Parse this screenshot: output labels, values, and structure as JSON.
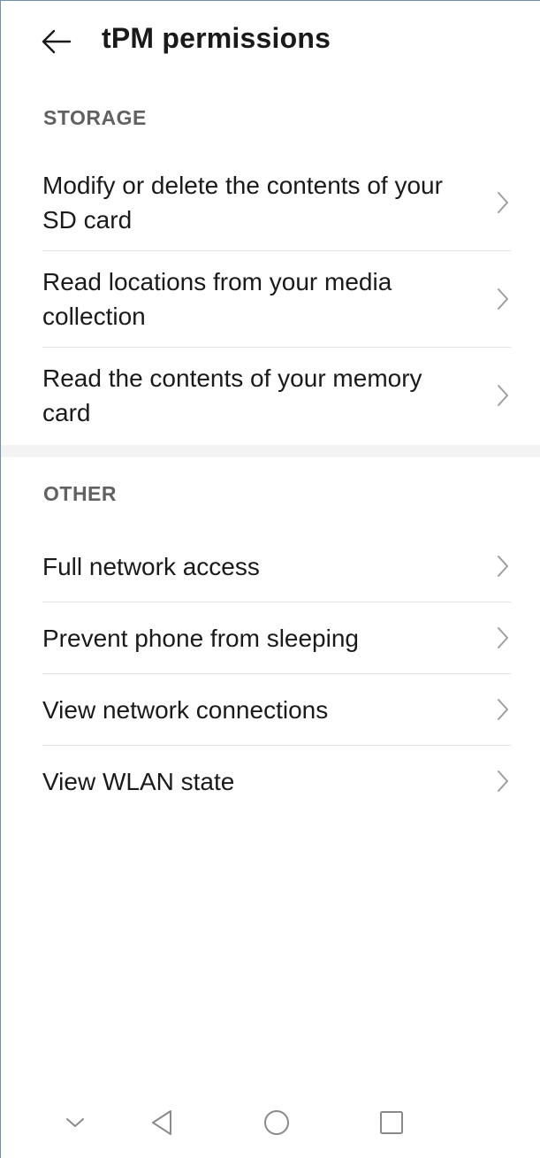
{
  "app_bar": {
    "back_icon": "arrow-left-icon",
    "title": "tPM permissions"
  },
  "sections": [
    {
      "header": "STORAGE",
      "items": [
        {
          "label": "Modify or delete the contents of your SD card",
          "icon": "chevron-right-icon"
        },
        {
          "label": "Read locations from your media collection",
          "icon": "chevron-right-icon"
        },
        {
          "label": "Read the contents of your memory card",
          "icon": "chevron-right-icon"
        }
      ]
    },
    {
      "header": "OTHER",
      "items": [
        {
          "label": "Full network access",
          "icon": "chevron-right-icon"
        },
        {
          "label": "Prevent phone from sleeping",
          "icon": "chevron-right-icon"
        },
        {
          "label": "View network connections",
          "icon": "chevron-right-icon"
        },
        {
          "label": "View WLAN state",
          "icon": "chevron-right-icon"
        }
      ]
    }
  ],
  "nav_bar": {
    "icons": [
      "chevron-down-icon",
      "back-triangle-icon",
      "home-circle-icon",
      "recents-square-icon"
    ]
  },
  "colors": {
    "text_primary": "#1a1a1a",
    "section_header": "#616161",
    "divider": "#e2e2e2",
    "chevron": "#9e9e9e",
    "nav_icon": "#8a8a8a",
    "band": "#f3f3f3"
  }
}
